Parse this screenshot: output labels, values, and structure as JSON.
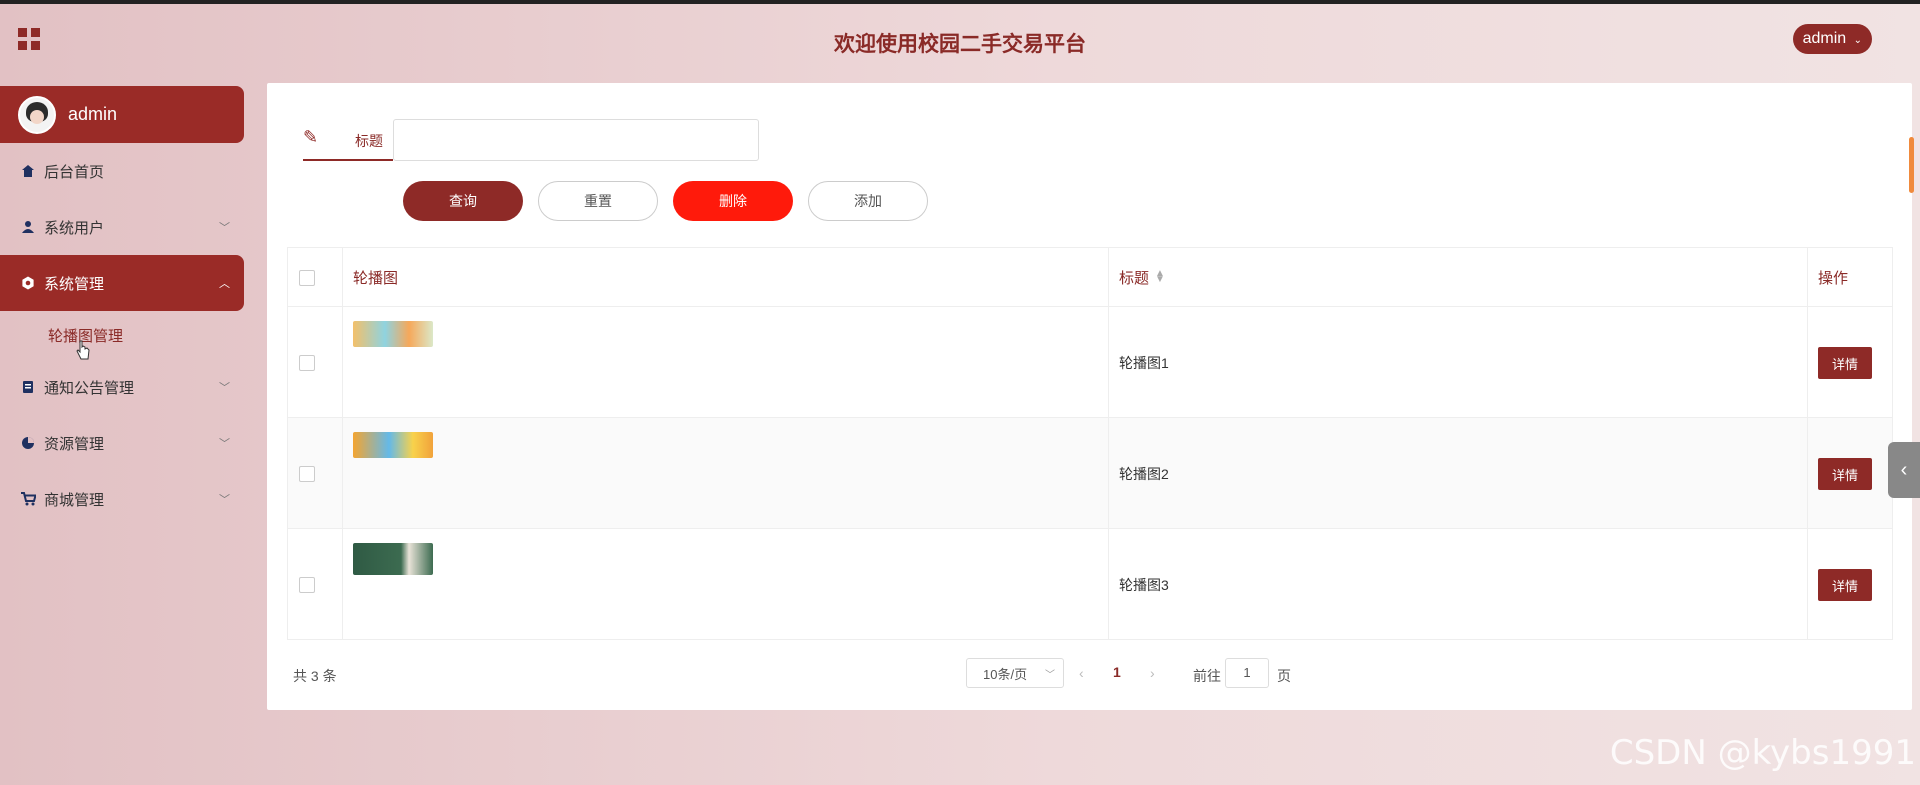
{
  "header": {
    "app_title": "欢迎使用校园二手交易平台",
    "user_menu_label": "admin",
    "caret": "⌄"
  },
  "sidebar": {
    "profile_name": "admin",
    "items": [
      {
        "label": "后台首页",
        "icon": "home-icon"
      },
      {
        "label": "系统用户",
        "icon": "user-icon"
      },
      {
        "label": "系统管理",
        "icon": "settings-hex-icon"
      },
      {
        "label": "通知公告管理",
        "icon": "notice-icon"
      },
      {
        "label": "资源管理",
        "icon": "pie-chart-icon"
      },
      {
        "label": "商城管理",
        "icon": "cart-icon"
      }
    ],
    "sub_items": [
      {
        "label": "轮播图管理"
      }
    ]
  },
  "search": {
    "label": "标题",
    "value": "",
    "placeholder": ""
  },
  "buttons": {
    "query": "查询",
    "reset": "重置",
    "delete": "删除",
    "add": "添加"
  },
  "table": {
    "columns": [
      "轮播图",
      "标题",
      "操作"
    ],
    "rows": [
      {
        "title": "轮播图1",
        "action": "详情"
      },
      {
        "title": "轮播图2",
        "action": "详情"
      },
      {
        "title": "轮播图3",
        "action": "详情"
      }
    ]
  },
  "pagination": {
    "total": "共 3 条",
    "page_size": "10条/页",
    "current_page": "1",
    "goto_label": "前往",
    "goto_value": "1",
    "page_word": "页"
  },
  "watermark": "CSDN @kybs1991",
  "colors": {
    "primary": "#8e2a27",
    "danger": "#ff1a0b"
  }
}
